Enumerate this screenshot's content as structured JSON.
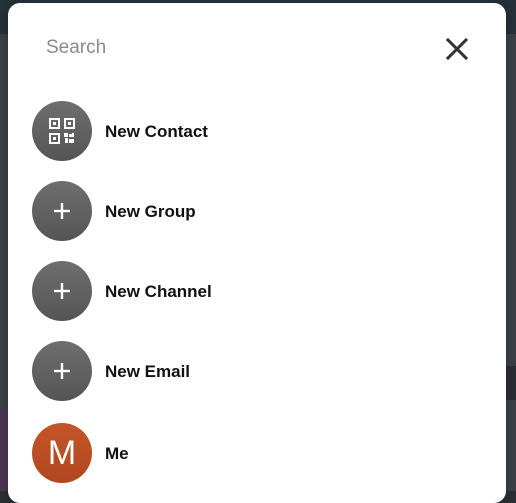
{
  "search": {
    "placeholder": "Search"
  },
  "items": [
    {
      "label": "New Contact",
      "icon": "qr-code-icon"
    },
    {
      "label": "New Group",
      "icon": "plus-icon"
    },
    {
      "label": "New Channel",
      "icon": "plus-icon"
    },
    {
      "label": "New Email",
      "icon": "plus-icon"
    },
    {
      "label": "Me",
      "avatar_letter": "M"
    }
  ],
  "colors": {
    "dialog_bg": "#ffffff",
    "icon_avatar": "#5f5f5f",
    "me_avatar": "#bb4e24"
  }
}
